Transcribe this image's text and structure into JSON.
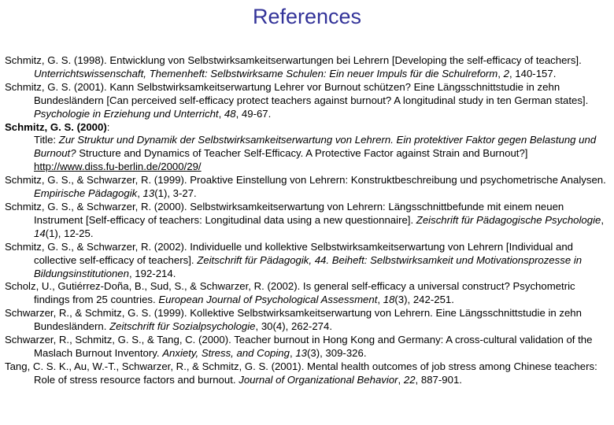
{
  "title": "References",
  "references": [
    {
      "segments": [
        {
          "t": "Schmitz, G. S. (1998). Entwicklung von Selbstwirksamkeitserwartungen bei Lehrern [Developing the self-efficacy of teachers]. "
        },
        {
          "t": "Unterrichtswissenschaft, Themenheft: Selbstwirksame Schulen: Ein neuer Impuls für die Schulreform",
          "i": true
        },
        {
          "t": ", "
        },
        {
          "t": "2",
          "i": true
        },
        {
          "t": ", 140-157."
        }
      ]
    },
    {
      "segments": [
        {
          "t": "Schmitz, G. S. (2001). Kann Selbstwirksamkeitserwartung Lehrer vor Burnout schützen? Eine Längsschnittstudie in zehn Bundesländern [Can perceived self-efficacy protect teachers against burnout? A longitudinal study in ten German states]. "
        },
        {
          "t": "Psychologie in Erziehung und Unterricht",
          "i": true
        },
        {
          "t": ", "
        },
        {
          "t": "48",
          "i": true
        },
        {
          "t": ", 49-67."
        }
      ]
    },
    {
      "segments": [
        {
          "t": "Schmitz, G. S. (2000)",
          "b": true
        },
        {
          "t": ":"
        }
      ],
      "sub_lines": [
        {
          "segments": [
            {
              "t": "Title: "
            },
            {
              "t": "Zur Struktur und Dynamik der Selbstwirksamkeitserwartung von Lehrern. Ein protektiver Faktor gegen Belastung und Burnout?",
              "i": true
            },
            {
              "t": " Structure and Dynamics of Teacher Self-Efficacy. A Protective Factor against Strain and Burnout?]"
            }
          ]
        },
        {
          "segments": [
            {
              "t": "http://www.diss.fu-berlin.de/2000/29/",
              "link": true
            }
          ]
        }
      ]
    },
    {
      "segments": [
        {
          "t": "Schmitz, G. S., & Schwarzer, R. (1999). Proaktive Einstellung von Lehrern: Konstruktbeschreibung und psychometrische Analysen. "
        },
        {
          "t": "Empirische Pädagogik",
          "i": true
        },
        {
          "t": ", "
        },
        {
          "t": "13",
          "i": true
        },
        {
          "t": "(1), 3-27."
        }
      ]
    },
    {
      "segments": [
        {
          "t": "Schmitz, G. S., & Schwarzer, R. (2000). Selbstwirksamkeitserwartung von Lehrern: Längsschnittbefunde mit einem neuen Instrument [Self-efficacy of teachers: Longitudinal data using a new questionnaire]. "
        },
        {
          "t": "Zeischrift für Pädagogische Psychologie",
          "i": true
        },
        {
          "t": ", "
        },
        {
          "t": "14",
          "i": true
        },
        {
          "t": "(1), 12-25."
        }
      ]
    },
    {
      "segments": [
        {
          "t": "Schmitz, G. S., & Schwarzer, R. (2002). Individuelle und kollektive Selbstwirksamkeitserwartung von Lehrern [Individual and collective self-efficacy of teachers]. "
        },
        {
          "t": "Zeitschrift für Pädagogik, 44. Beiheft: Selbstwirksamkeit und Motivationsprozesse in Bildungsinstitutionen",
          "i": true
        },
        {
          "t": ", 192-214."
        }
      ]
    },
    {
      "segments": [
        {
          "t": "Scholz, U., Gutiérrez-Doña, B., Sud, S., & Schwarzer, R. (2002). Is general self-efficacy a universal construct? Psychometric findings from 25 countries. "
        },
        {
          "t": "European Journal of Psychological Assessment",
          "i": true
        },
        {
          "t": ", "
        },
        {
          "t": "18",
          "i": true
        },
        {
          "t": "(3), 242-251."
        }
      ]
    },
    {
      "segments": [
        {
          "t": "Schwarzer, R., & Schmitz, G. S. (1999). Kollektive Selbstwirksamkeitserwartung von Lehrern. Eine Längsschnittstudie in zehn Bundesländern. "
        },
        {
          "t": "Zeitschrift für Sozialpsychologie",
          "i": true
        },
        {
          "t": ", 30(4), 262-274."
        }
      ]
    },
    {
      "segments": [
        {
          "t": "Schwarzer, R., Schmitz, G. S., & Tang, C. (2000). Teacher burnout in Hong Kong and Germany: A cross-cultural validation of the Maslach Burnout Inventory. "
        },
        {
          "t": "Anxiety, Stress, and Coping",
          "i": true
        },
        {
          "t": ", "
        },
        {
          "t": "13",
          "i": true
        },
        {
          "t": "(3), 309-326."
        }
      ]
    },
    {
      "segments": [
        {
          "t": "Tang, C. S. K., Au, W.-T., Schwarzer, R., & Schmitz, G. S. (2001). Mental health outcomes of job stress among Chinese teachers: Role of stress resource factors and burnout. "
        },
        {
          "t": "Journal of Organizational Behavior",
          "i": true
        },
        {
          "t": ", "
        },
        {
          "t": "22",
          "i": true
        },
        {
          "t": ", 887-901."
        }
      ]
    }
  ]
}
